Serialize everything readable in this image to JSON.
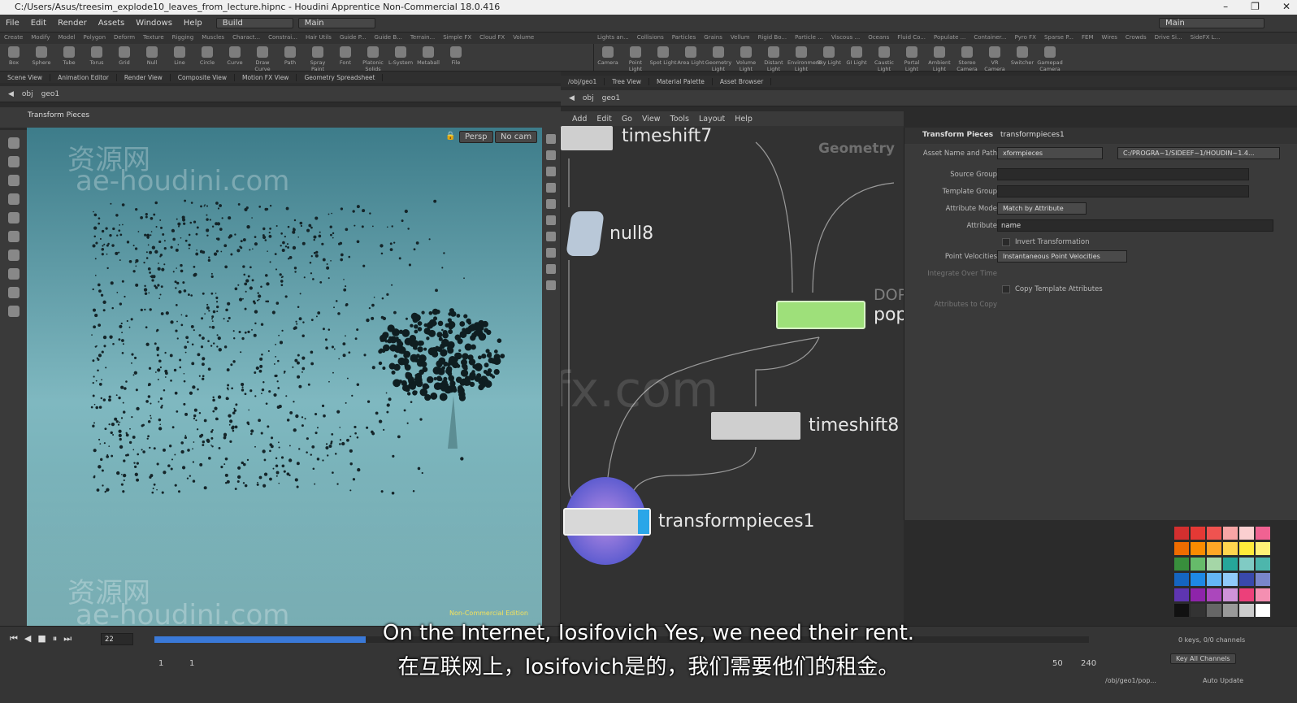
{
  "titlebar": {
    "title": "C:/Users/Asus/treesim_explode10_leaves_from_lecture.hipnc - Houdini Apprentice Non-Commercial 18.0.416",
    "win_controls": [
      "–",
      "❐",
      "✕"
    ]
  },
  "menubar": {
    "items": [
      "File",
      "Edit",
      "Render",
      "Assets",
      "Windows",
      "Help"
    ],
    "desktop": "Build",
    "main": "Main",
    "right_main": "Main"
  },
  "shelf_tabs_left": [
    "Create",
    "Modify",
    "Model",
    "Polygon",
    "Deform",
    "Texture",
    "Rigging",
    "Muscles",
    "Charact...",
    "Constrai...",
    "Hair Utils",
    "Guide P...",
    "Guide B...",
    "Terrain...",
    "Simple FX",
    "Cloud FX",
    "Volume"
  ],
  "shelf_tabs_right": [
    "Lights an...",
    "Collisions",
    "Particles",
    "Grains",
    "Vellum",
    "Rigid Bo...",
    "Particle ...",
    "Viscous ...",
    "Oceans",
    "Fluid Co...",
    "Populate ...",
    "Container...",
    "Pyro FX",
    "Sparse P...",
    "FEM",
    "Wires",
    "Crowds",
    "Drive Si...",
    "SideFX L..."
  ],
  "shelf_tools_left": [
    "Box",
    "Sphere",
    "Tube",
    "Torus",
    "Grid",
    "Null",
    "Line",
    "Circle",
    "Curve",
    "Draw Curve",
    "Path",
    "Spray Paint",
    "Font",
    "Platonic Solids",
    "L-System",
    "Metaball",
    "File"
  ],
  "shelf_tools_right": [
    "Camera",
    "Point Light",
    "Spot Light",
    "Area Light",
    "Geometry Light",
    "Volume Light",
    "Distant Light",
    "Environment Light",
    "Sky Light",
    "GI Light",
    "Caustic Light",
    "Portal Light",
    "Ambient Light",
    "Stereo Camera",
    "VR Camera",
    "Switcher",
    "Gamepad Camera"
  ],
  "left_pane": {
    "tabs": [
      "Scene View",
      "Animation Editor",
      "Render View",
      "Composite View",
      "Motion FX View",
      "Geometry Spreadsheet"
    ],
    "path": [
      "obj",
      "geo1"
    ],
    "title": "Transform Pieces",
    "persp": "Persp",
    "cam": "No cam",
    "watermark1": "资源网",
    "watermark2": "ae-houdini.com",
    "status": "Non-Commercial Edition"
  },
  "right_pane": {
    "tabs": [
      "/obj/geo1",
      "Tree View",
      "Material Palette",
      "Asset Browser"
    ],
    "path": [
      "obj",
      "geo1"
    ],
    "menu": [
      "Add",
      "Edit",
      "Go",
      "View",
      "Tools",
      "Layout",
      "Help"
    ],
    "context": "Geometry",
    "nodes": {
      "timeshift7": "timeshift7",
      "null8": "null8",
      "pop": "pop",
      "dop": "DOP",
      "timeshift8": "timeshift8",
      "transformpieces": "transformpieces1"
    },
    "watermark": "iiivfx.com"
  },
  "params": {
    "type": "Transform Pieces",
    "name": "transformpieces1",
    "asset_label": "Asset Name and Path",
    "asset_value": "xformpieces",
    "asset_path": "C:/PROGRA~1/SIDEEF~1/HOUDIN~1.4...",
    "source_group": "Source Group",
    "template_group": "Template Group",
    "attr_mode_label": "Attribute Mode",
    "attr_mode_value": "Match by Attribute",
    "attribute_label": "Attribute",
    "attribute_value": "name",
    "invert": "Invert Transformation",
    "pv_label": "Point Velocities",
    "pv_value": "Instantaneous Point Velocities",
    "integrate": "Integrate Over Time",
    "copy_template": "Copy Template Attributes",
    "attrs_to_copy": "Attributes to Copy"
  },
  "timeline": {
    "frame": "22",
    "start": "1",
    "start2": "1",
    "end1": "50",
    "end2": "240",
    "keys": "0 keys, 0/0 channels",
    "key_all": "Key All Channels",
    "path": "/obj/geo1/pop...",
    "auto_update": "Auto Update"
  },
  "subtitles": {
    "en": "On the Internet, Iosifovich Yes, we need their rent.",
    "zh": "在互联网上，Iosifovich是的，我们需要他们的租金。"
  },
  "colors": {
    "node_green": "#9ee07a",
    "node_blue": "#2aa6e8",
    "accent_purple": "#7a5bd0"
  }
}
